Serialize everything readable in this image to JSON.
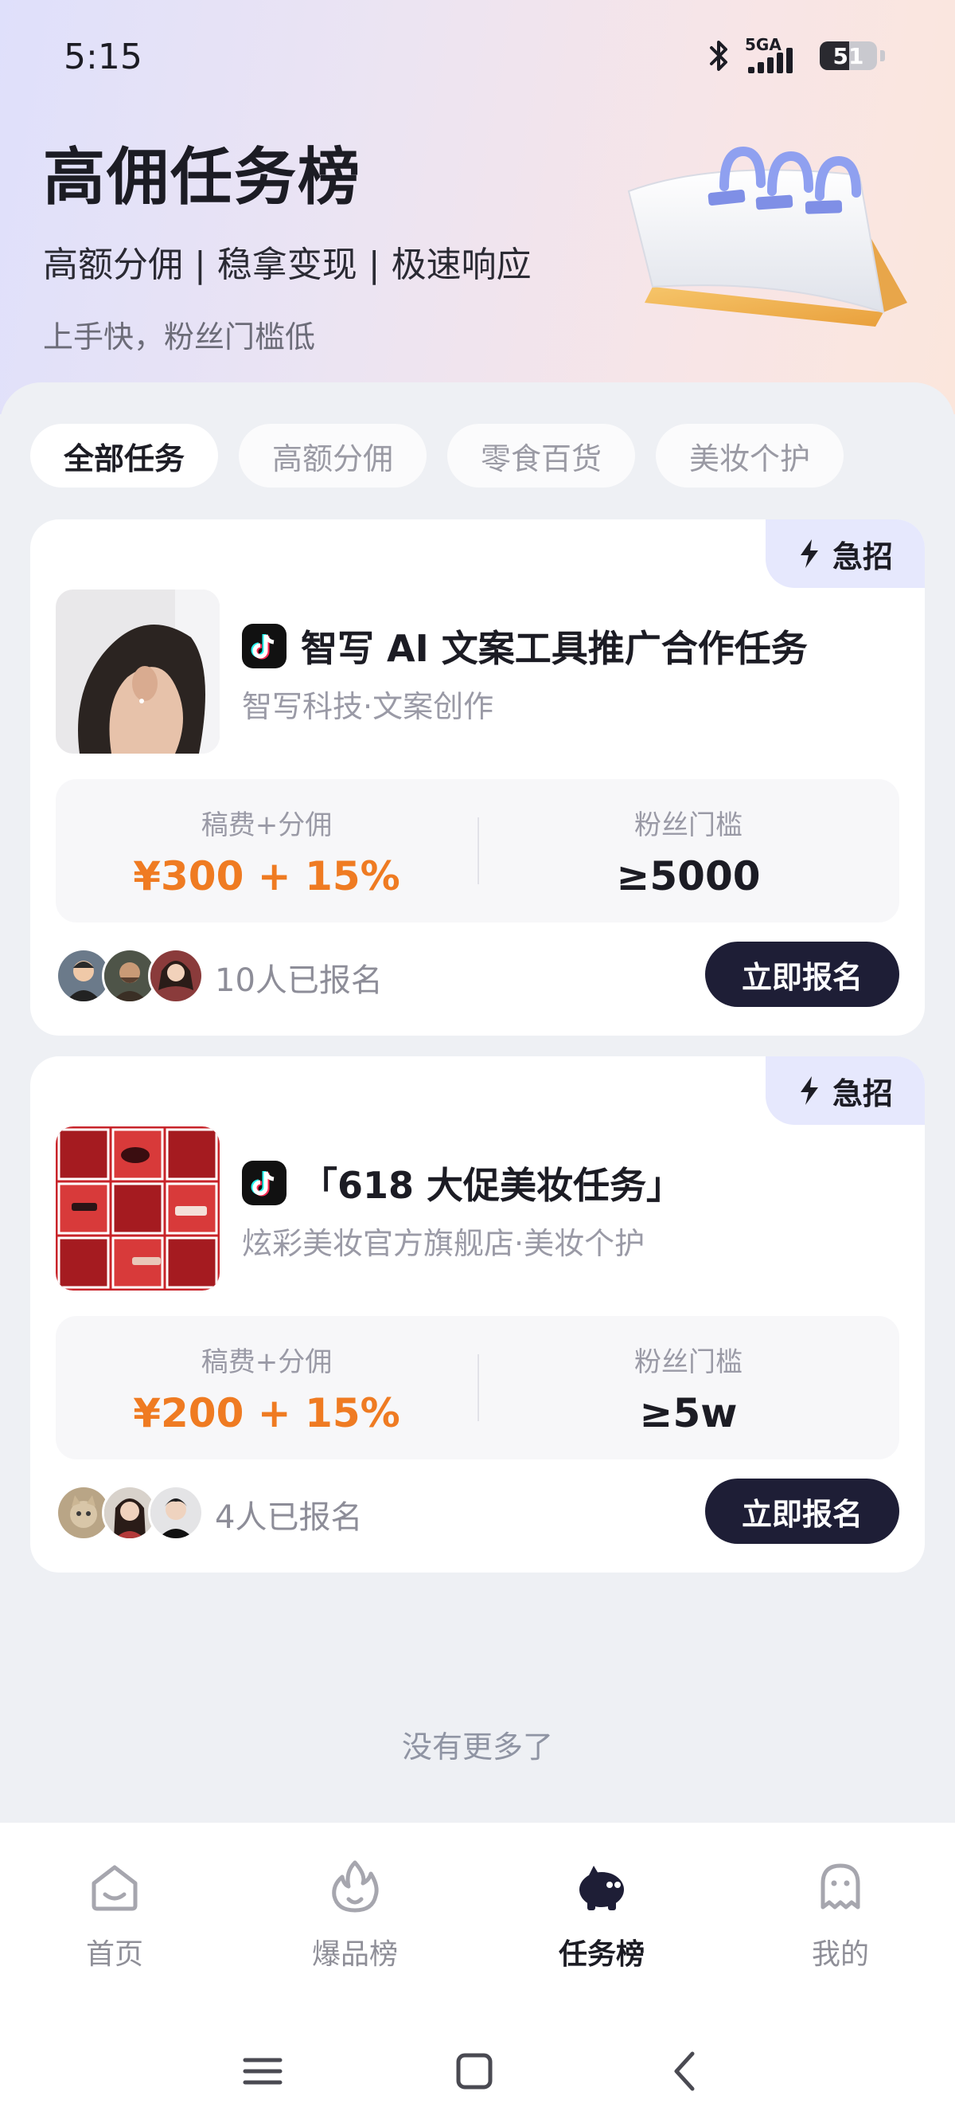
{
  "status_bar": {
    "time": "5:15",
    "network": "5GA",
    "battery": "51",
    "battery_level": 0.51
  },
  "header": {
    "title": "高佣任务榜",
    "subtitle": "高额分佣 | 稳拿变现 | 极速响应",
    "tagline": "上手快，粉丝门槛低"
  },
  "tabs": [
    {
      "label": "全部任务",
      "active": true
    },
    {
      "label": "高额分佣",
      "active": false
    },
    {
      "label": "零食百货",
      "active": false
    },
    {
      "label": "美妆个护",
      "active": false
    }
  ],
  "tasks": [
    {
      "badge": "急招",
      "title": "智写 AI 文案工具推广合作任务",
      "company": "智写科技·文案创作",
      "fee_label": "稿费+分佣",
      "fee_value": "¥300 + 15%",
      "threshold_label": "粉丝门槛",
      "threshold_value": "≥5000",
      "enroll_count": "10人已报名",
      "action_label": "立即报名"
    },
    {
      "badge": "急招",
      "title": "「618 大促美妆任务」",
      "company": "炫彩美妆官方旗舰店·美妆个护",
      "fee_label": "稿费+分佣",
      "fee_value": "¥200 + 15%",
      "threshold_label": "粉丝门槛",
      "threshold_value": "≥5w",
      "enroll_count": "4人已报名",
      "action_label": "立即报名"
    }
  ],
  "footer_note": "没有更多了",
  "bottom_nav": [
    {
      "label": "首页",
      "icon": "home-icon",
      "active": false
    },
    {
      "label": "爆品榜",
      "icon": "flame-icon",
      "active": false
    },
    {
      "label": "任务榜",
      "icon": "piggy-bank-icon",
      "active": true
    },
    {
      "label": "我的",
      "icon": "profile-icon",
      "active": false
    }
  ],
  "colors": {
    "accent_orange": "#ef7b22",
    "button_dark": "#1e1e36",
    "badge_bg": "#e6e8fd"
  }
}
